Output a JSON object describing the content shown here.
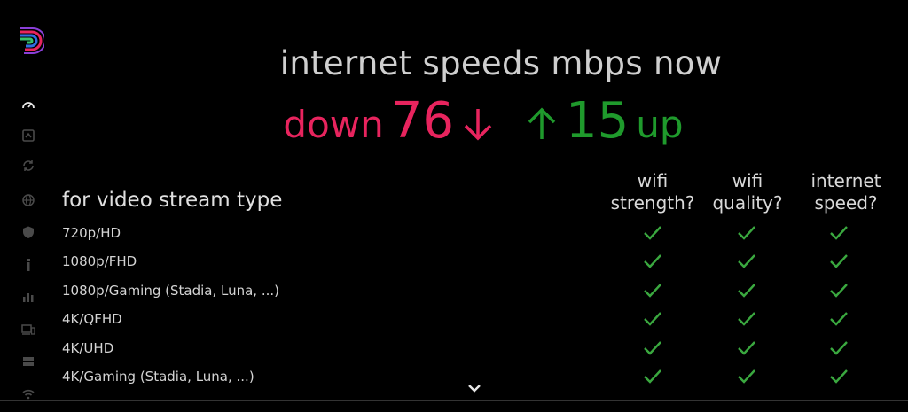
{
  "header": {
    "title": "internet speeds mbps now"
  },
  "speeds": {
    "down_label": "down",
    "down_value": "76",
    "up_value": "15",
    "up_label": "up",
    "down_color": "#e8245e",
    "up_color": "#1f9a2c"
  },
  "table": {
    "section_title": "for video stream type",
    "columns": [
      {
        "line1": "wifi",
        "line2": "strength?"
      },
      {
        "line1": "wifi",
        "line2": "quality?"
      },
      {
        "line1": "internet",
        "line2": "speed?"
      }
    ],
    "rows": [
      {
        "label": "720p/HD",
        "checks": [
          true,
          true,
          true
        ]
      },
      {
        "label": "1080p/FHD",
        "checks": [
          true,
          true,
          true
        ]
      },
      {
        "label": "1080p/Gaming (Stadia, Luna, ...)",
        "checks": [
          true,
          true,
          true
        ]
      },
      {
        "label": "4K/QFHD",
        "checks": [
          true,
          true,
          true
        ]
      },
      {
        "label": "4K/UHD",
        "checks": [
          true,
          true,
          true
        ]
      },
      {
        "label": "4K/Gaming (Stadia, Luna, ...)",
        "checks": [
          true,
          true,
          true
        ]
      }
    ],
    "check_color": "#3aa83f"
  },
  "sidebar": {
    "items": [
      {
        "icon": "speedometer-icon"
      },
      {
        "icon": "history-icon"
      },
      {
        "icon": "refresh-icon"
      },
      {
        "icon": "globe-icon"
      },
      {
        "icon": "shield-icon"
      },
      {
        "icon": "router-icon"
      },
      {
        "icon": "bar-chart-icon"
      },
      {
        "icon": "devices-icon"
      },
      {
        "icon": "storage-icon"
      },
      {
        "icon": "wifi-icon"
      }
    ]
  }
}
